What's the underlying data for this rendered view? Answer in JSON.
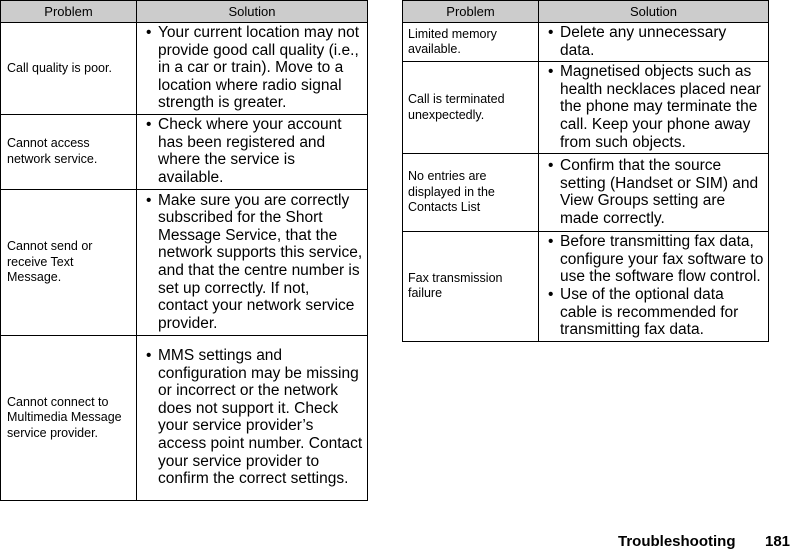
{
  "left_table": {
    "headers": [
      "Problem",
      "Solution"
    ],
    "rows": [
      {
        "problem": "Call quality is poor.",
        "solutions": [
          "Your current location may not provide good call quality (i.e., in a car or train). Move to a location where radio signal strength is greater."
        ]
      },
      {
        "problem": "Cannot access network service.",
        "solutions": [
          "Check where your account has been registered and where the service is available."
        ]
      },
      {
        "problem": "Cannot send or receive Text Message.",
        "solutions": [
          "Make sure you are correctly subscribed for the Short Message Service, that the network supports this service, and that the centre number is set up correctly. If not, contact your network service provider."
        ]
      },
      {
        "problem": "Cannot connect to Multimedia Message service provider.",
        "solutions": [
          "MMS settings and configuration may be missing or incorrect or the network does not support it. Check your service provider’s access point number. Contact your service provider to confirm the correct settings."
        ]
      }
    ]
  },
  "right_table": {
    "headers": [
      "Problem",
      "Solution"
    ],
    "rows": [
      {
        "problem": "Limited memory available.",
        "solutions": [
          "Delete any unnecessary data."
        ]
      },
      {
        "problem": "Call is terminated unexpectedly.",
        "solutions": [
          "Magnetised objects such as health necklaces placed near the phone may terminate the call. Keep your phone away from such objects."
        ]
      },
      {
        "problem": "No entries are displayed in the Contacts List",
        "solutions": [
          "Confirm that the source setting (Handset or SIM) and View Groups setting are made correctly."
        ]
      },
      {
        "problem": "Fax transmission failure",
        "solutions": [
          "Before transmitting fax data, configure your fax software to use the software flow control.",
          "Use of the optional data cable is recommended for transmitting fax data."
        ]
      }
    ]
  },
  "bullet": "•",
  "footer": {
    "section": "Troubleshooting",
    "page": "181"
  }
}
